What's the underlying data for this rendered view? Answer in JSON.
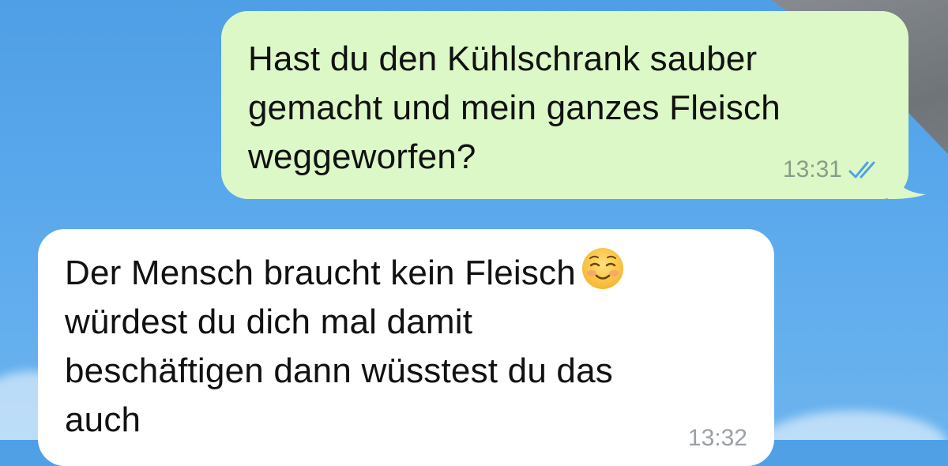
{
  "chat": {
    "messages": [
      {
        "direction": "outgoing",
        "text": "Hast du den Kühlschrank sauber\ngemacht und mein ganzes Fleisch\nweggeworfen?",
        "time": "13:31",
        "status_icon": "double-check-read-icon",
        "bubble_color": "#dcf8c6",
        "check_color": "#4fa3e8"
      },
      {
        "direction": "incoming",
        "text_before_emoji": "Der Mensch braucht kein Fleisch",
        "emoji_icon": "smiling-face-icon",
        "text_after_emoji": "würdest du dich mal damit\nbeschäftigen dann wüsstest du das\nauch",
        "time": "13:32",
        "bubble_color": "#ffffff"
      }
    ]
  }
}
